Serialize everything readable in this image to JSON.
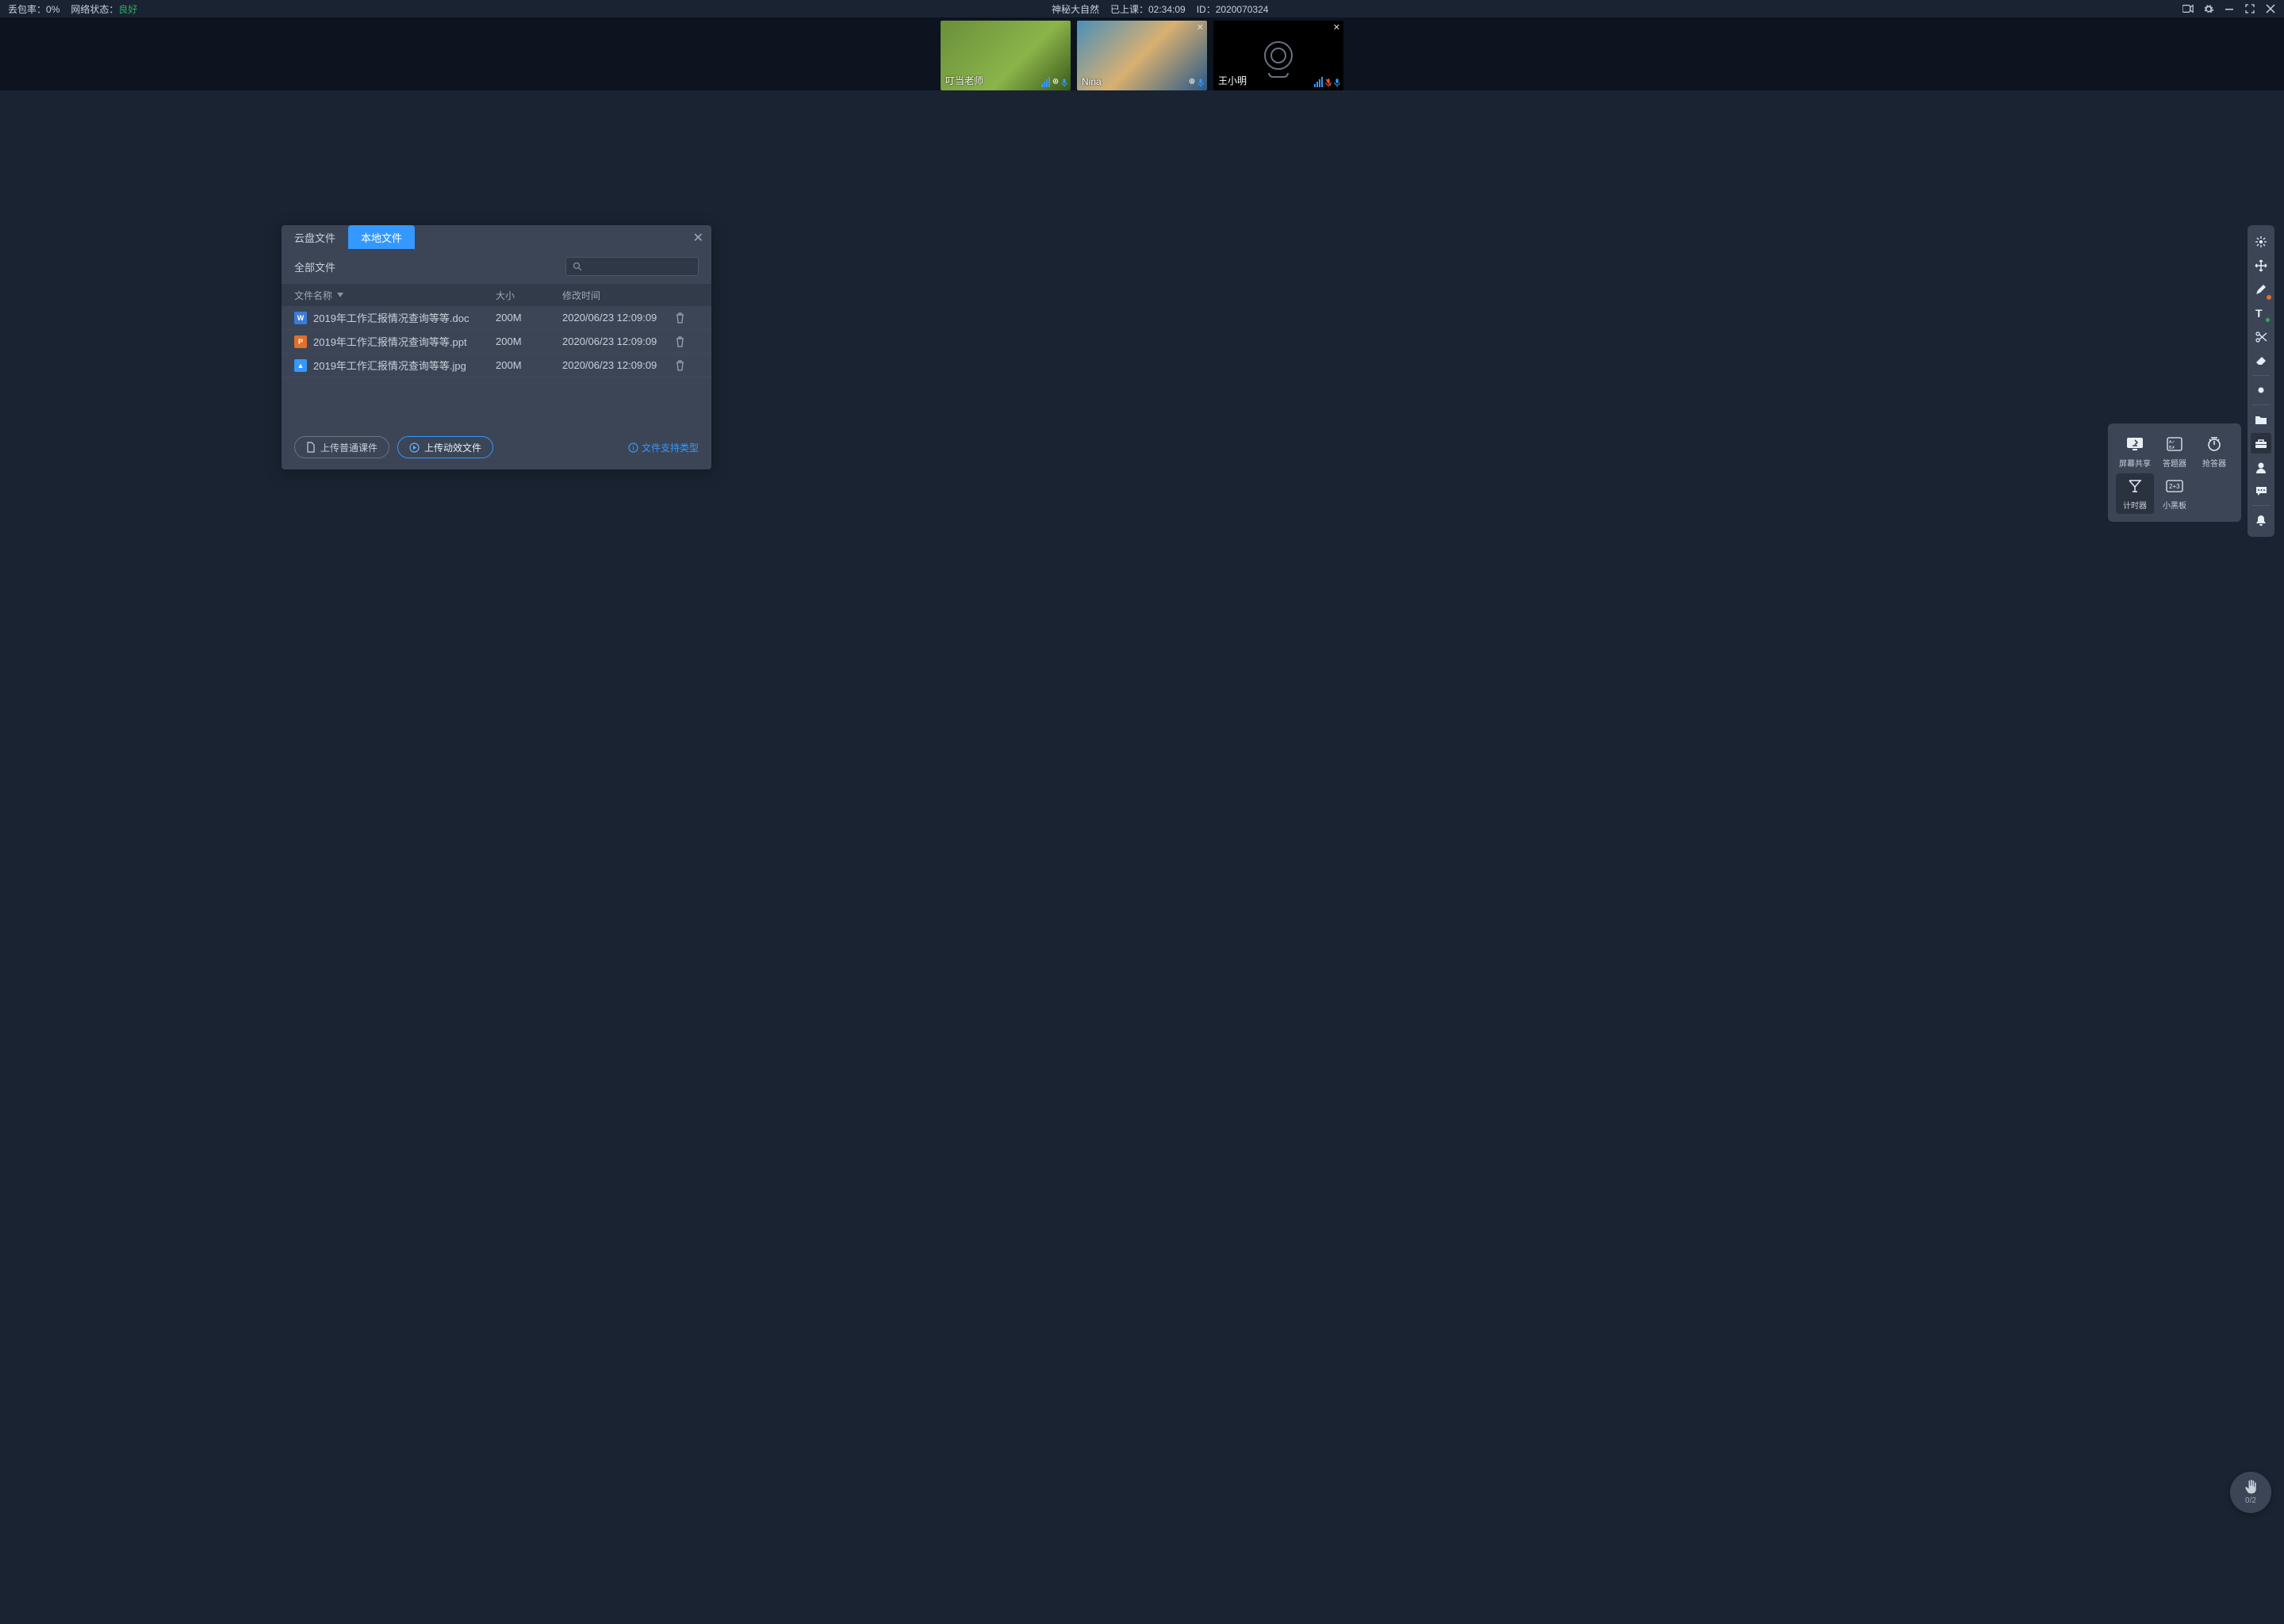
{
  "topbar": {
    "packet_loss_label": "丢包率：",
    "packet_loss_value": "0%",
    "net_status_label": "网络状态：",
    "net_status_value": "良好",
    "course_title": "神秘大自然",
    "elapsed_label": "已上课：",
    "elapsed_value": "02:34:09",
    "id_label": "ID：",
    "id_value": "2020070324"
  },
  "videos": [
    {
      "name": "叮当老师",
      "type": "face1",
      "closeable": false,
      "mic_on": true
    },
    {
      "name": "Nina",
      "type": "face2",
      "closeable": true,
      "mic_on": true
    },
    {
      "name": "王小明",
      "type": "off",
      "closeable": true,
      "mic_on": true,
      "mic_muted": true
    }
  ],
  "dialog": {
    "tabs": {
      "cloud": "云盘文件",
      "local": "本地文件"
    },
    "all_files": "全部文件",
    "columns": {
      "name": "文件名称",
      "size": "大小",
      "mtime": "修改时间"
    },
    "rows": [
      {
        "icon": "doc",
        "letter": "W",
        "name": "2019年工作汇报情况查询等等.doc",
        "size": "200M",
        "mtime": "2020/06/23 12:09:09"
      },
      {
        "icon": "ppt",
        "letter": "P",
        "name": "2019年工作汇报情况查询等等.ppt",
        "size": "200M",
        "mtime": "2020/06/23 12:09:09"
      },
      {
        "icon": "img",
        "letter": "▲",
        "name": "2019年工作汇报情况查询等等.jpg",
        "size": "200M",
        "mtime": "2020/06/23 12:09:09"
      }
    ],
    "upload_normal": "上传普通课件",
    "upload_animated": "上传动效文件",
    "supported_types": "文件支持类型"
  },
  "tools_popup": [
    {
      "id": "screen-share",
      "label": "屏幕共享"
    },
    {
      "id": "quiz",
      "label": "答题器"
    },
    {
      "id": "rush",
      "label": "抢答器"
    },
    {
      "id": "timer",
      "label": "计时器",
      "selected": true
    },
    {
      "id": "mini-board",
      "label": "小黑板"
    }
  ],
  "right_toolbar": [
    {
      "id": "laser",
      "sep": false
    },
    {
      "id": "move",
      "sep": false
    },
    {
      "id": "pen",
      "sep": false,
      "badge": "orange"
    },
    {
      "id": "text",
      "sep": false,
      "badge": "green"
    },
    {
      "id": "scissor",
      "sep": false
    },
    {
      "id": "eraser",
      "sep": true
    },
    {
      "id": "dot",
      "sep": true
    },
    {
      "id": "folder",
      "sep": false
    },
    {
      "id": "toolbox",
      "sep": false,
      "selected": true
    },
    {
      "id": "user",
      "sep": false
    },
    {
      "id": "chat",
      "sep": true
    },
    {
      "id": "bell",
      "sep": false
    }
  ],
  "hand": {
    "count": "0/2"
  }
}
